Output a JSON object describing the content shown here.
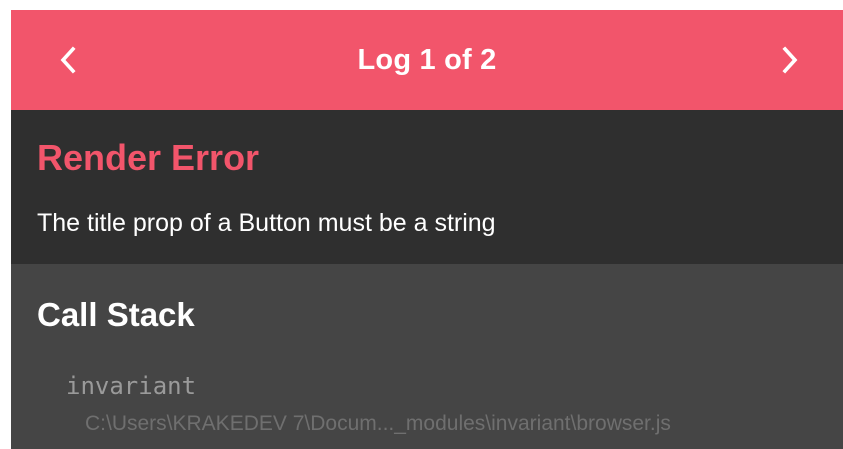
{
  "header": {
    "title": "Log 1 of 2",
    "prev_icon": "chevron-left-icon",
    "next_icon": "chevron-right-icon",
    "background": "#f2556b"
  },
  "error": {
    "title": "Render Error",
    "message": "The title prop of a Button must be a string",
    "title_color": "#f2556b"
  },
  "call_stack": {
    "heading": "Call Stack",
    "frames": [
      {
        "function": "invariant",
        "file": "C:\\Users\\KRAKEDEV 7\\Docum..._modules\\invariant\\browser.js"
      }
    ]
  }
}
